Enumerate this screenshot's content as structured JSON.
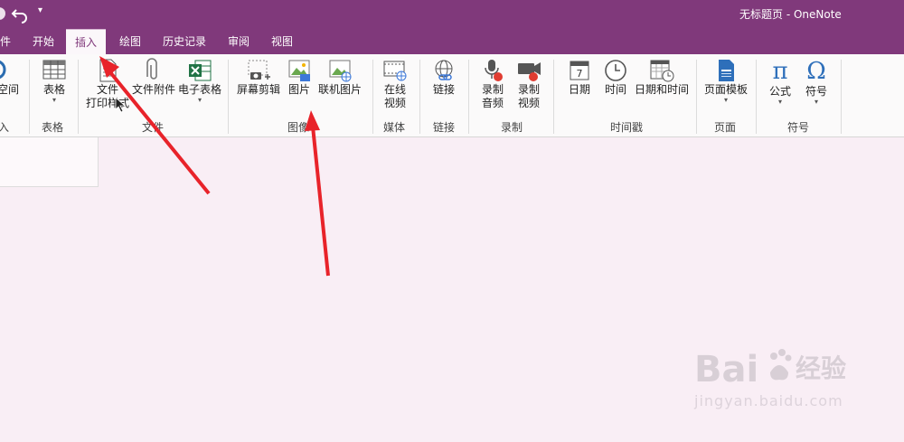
{
  "window": {
    "title": "无标题页  -  OneNote"
  },
  "quick_access": {
    "more": "▾"
  },
  "tabs": [
    {
      "label": "件"
    },
    {
      "label": "开始"
    },
    {
      "label": "插入"
    },
    {
      "label": "绘图"
    },
    {
      "label": "历史记录"
    },
    {
      "label": "审阅"
    },
    {
      "label": "视图"
    }
  ],
  "ribbon": {
    "insert_space": {
      "label": "空间"
    },
    "table": {
      "label": "表格"
    },
    "file_printout": {
      "line1": "文件",
      "line2": "打印样式"
    },
    "file_attachment": {
      "label": "文件附件"
    },
    "spreadsheet": {
      "label": "电子表格",
      "dd": "▾"
    },
    "screen_clipping": {
      "label": "屏幕剪辑"
    },
    "pictures": {
      "label": "图片"
    },
    "online_pictures": {
      "label": "联机图片"
    },
    "online_video": {
      "line1": "在线",
      "line2": "视频"
    },
    "link": {
      "label": "链接"
    },
    "record_audio": {
      "line1": "录制",
      "line2": "音频"
    },
    "record_video": {
      "line1": "录制",
      "line2": "视频"
    },
    "date": {
      "label": "日期",
      "calendar_number": "7"
    },
    "time": {
      "label": "时间"
    },
    "date_time": {
      "label": "日期和时间"
    },
    "page_templates": {
      "label": "页面模板",
      "dd": "▾"
    },
    "equation": {
      "label": "公式",
      "symbol": "π",
      "dd": "▾"
    },
    "symbol": {
      "label": "符号",
      "symbol": "Ω",
      "dd": "▾"
    }
  },
  "groups": [
    {
      "label": "入"
    },
    {
      "label": "表格"
    },
    {
      "label": "文件"
    },
    {
      "label": "图像"
    },
    {
      "label": "媒体"
    },
    {
      "label": "链接"
    },
    {
      "label": "录制"
    },
    {
      "label": "时间戳"
    },
    {
      "label": "页面"
    },
    {
      "label": "符号"
    }
  ],
  "watermark": {
    "logo": "Bai",
    "text": "经验",
    "url": "jingyan.baidu.com"
  },
  "colors": {
    "brand": "#80397b",
    "arrow": "#e8232a",
    "canvas": "#f9eef5"
  }
}
